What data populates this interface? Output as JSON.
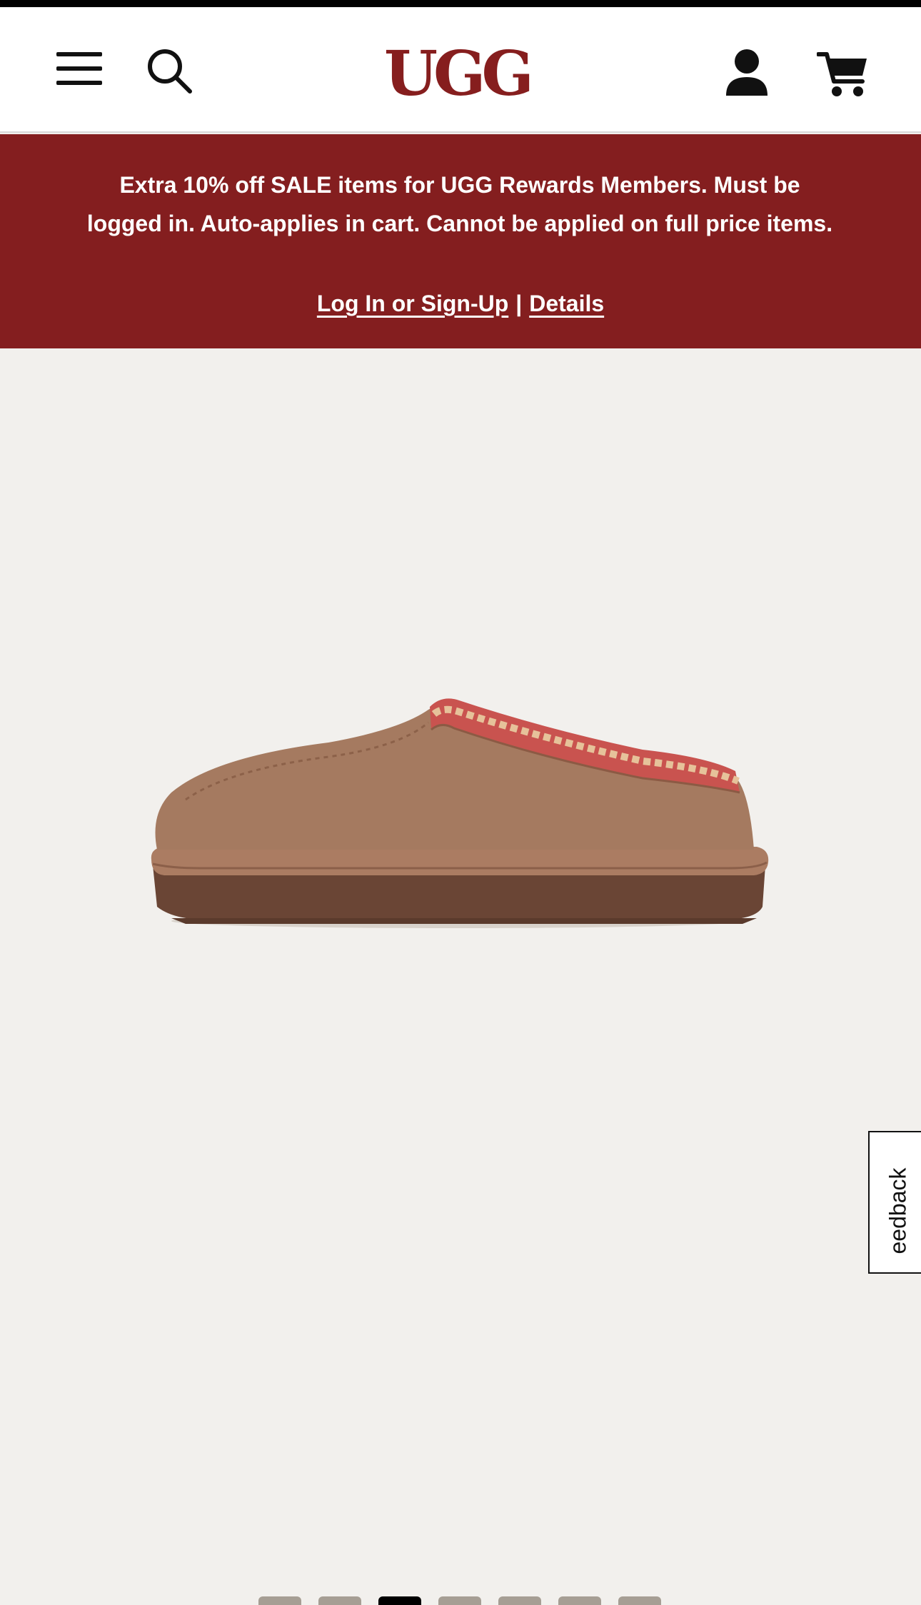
{
  "header": {
    "logo_text": "UGG",
    "icons": {
      "menu": "hamburger-menu-icon",
      "search": "search-icon",
      "account": "user-icon",
      "cart": "cart-icon"
    },
    "brand_color": "#861e1e"
  },
  "promo": {
    "message": "Extra 10% off SALE items for UGG Rewards Members. Must be logged in. Auto-applies in cart. Cannot be applied on full price items.",
    "login_link": "Log In or Sign-Up",
    "separator": "|",
    "details_link": "Details",
    "background_color": "#841e1f",
    "close_icon": "close-icon"
  },
  "gallery": {
    "image_count": 7,
    "active_index": 2
  },
  "feedback": {
    "label": "eedback"
  }
}
